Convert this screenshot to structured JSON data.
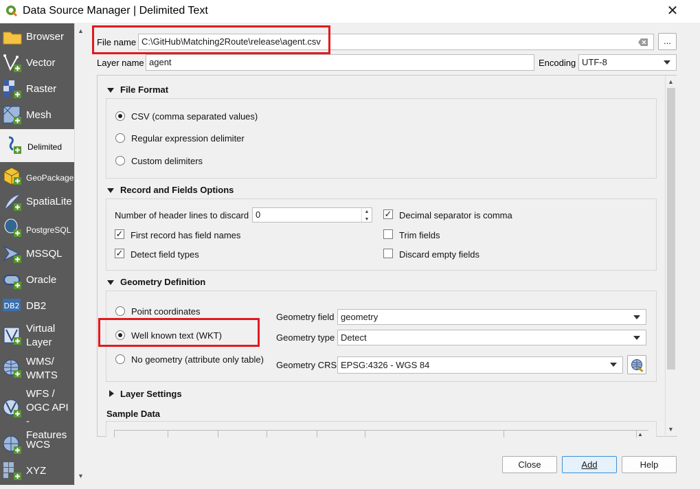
{
  "window": {
    "title": "Data Source Manager | Delimited Text",
    "close_glyph": "✕"
  },
  "sidebar": {
    "items": [
      {
        "label": "Browser",
        "icon": "folder-icon"
      },
      {
        "label": "Vector",
        "icon": "vector-icon"
      },
      {
        "label": "Raster",
        "icon": "raster-icon"
      },
      {
        "label": "Mesh",
        "icon": "mesh-icon"
      },
      {
        "label": "Delimited",
        "icon": "delimited-text-icon"
      },
      {
        "label": "GeoPackage",
        "icon": "geopackage-icon"
      },
      {
        "label": "SpatiaLite",
        "icon": "spatialite-icon"
      },
      {
        "label": "PostgreSQL",
        "icon": "postgresql-icon"
      },
      {
        "label": "MSSQL",
        "icon": "mssql-icon"
      },
      {
        "label": "Oracle",
        "icon": "oracle-icon"
      },
      {
        "label": "DB2",
        "icon": "db2-icon"
      },
      {
        "label": "Virtual\nLayer",
        "icon": "virtual-layer-icon"
      },
      {
        "label": "WMS/\nWMTS",
        "icon": "wms-icon"
      },
      {
        "label": "WFS /\nOGC API -\nFeatures",
        "icon": "wfs-icon"
      },
      {
        "label": "WCS",
        "icon": "wcs-icon"
      },
      {
        "label": "XYZ",
        "icon": "xyz-icon"
      }
    ],
    "db2_badge": "DB2"
  },
  "file": {
    "label": "File name",
    "value": "C:\\GitHub\\Matching2Route\\release\\agent.csv",
    "browse_label": "..."
  },
  "layer": {
    "label": "Layer name",
    "value": "agent"
  },
  "encoding": {
    "label": "Encoding",
    "value": "UTF-8"
  },
  "file_format": {
    "title": "File Format",
    "options": [
      "CSV (comma separated values)",
      "Regular expression delimiter",
      "Custom delimiters"
    ],
    "selected": 0
  },
  "record_fields": {
    "title": "Record and Fields Options",
    "header_lines_label": "Number of header lines to discard",
    "header_lines_value": "0",
    "decimal_comma": {
      "label": "Decimal separator is comma",
      "checked": true
    },
    "first_record": {
      "label": "First record has field names",
      "checked": true
    },
    "trim_fields": {
      "label": "Trim fields",
      "checked": false
    },
    "detect_types": {
      "label": "Detect field types",
      "checked": true
    },
    "discard_empty": {
      "label": "Discard empty fields",
      "checked": false
    },
    "check_glyph": "✓"
  },
  "geometry": {
    "title": "Geometry Definition",
    "options": [
      "Point coordinates",
      "Well known text (WKT)",
      "No geometry (attribute only table)"
    ],
    "selected": 1,
    "field_label": "Geometry field",
    "field_value": "geometry",
    "type_label": "Geometry type",
    "type_value": "Detect",
    "crs_label": "Geometry CRS",
    "crs_value": "EPSG:4326 - WGS 84"
  },
  "layer_settings": {
    "title": "Layer Settings"
  },
  "sample_data": {
    "title": "Sample Data"
  },
  "buttons": {
    "close": "Close",
    "add": "Add",
    "help": "Help"
  },
  "colors": {
    "highlight": "#e2191f",
    "sidebar": "#5a5a5a"
  }
}
